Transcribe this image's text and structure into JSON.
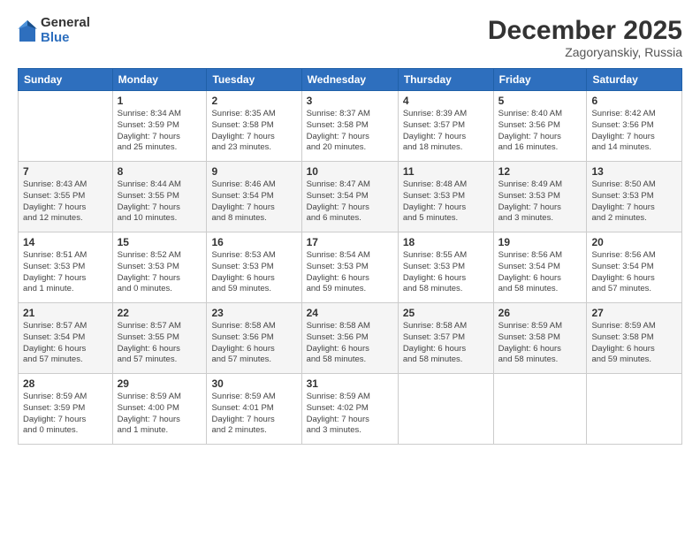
{
  "header": {
    "logo": {
      "general": "General",
      "blue": "Blue"
    },
    "title": "December 2025",
    "subtitle": "Zagoryanskiy, Russia"
  },
  "days_of_week": [
    "Sunday",
    "Monday",
    "Tuesday",
    "Wednesday",
    "Thursday",
    "Friday",
    "Saturday"
  ],
  "weeks": [
    [
      {
        "day": "",
        "info": ""
      },
      {
        "day": "1",
        "info": "Sunrise: 8:34 AM\nSunset: 3:59 PM\nDaylight: 7 hours\nand 25 minutes."
      },
      {
        "day": "2",
        "info": "Sunrise: 8:35 AM\nSunset: 3:58 PM\nDaylight: 7 hours\nand 23 minutes."
      },
      {
        "day": "3",
        "info": "Sunrise: 8:37 AM\nSunset: 3:58 PM\nDaylight: 7 hours\nand 20 minutes."
      },
      {
        "day": "4",
        "info": "Sunrise: 8:39 AM\nSunset: 3:57 PM\nDaylight: 7 hours\nand 18 minutes."
      },
      {
        "day": "5",
        "info": "Sunrise: 8:40 AM\nSunset: 3:56 PM\nDaylight: 7 hours\nand 16 minutes."
      },
      {
        "day": "6",
        "info": "Sunrise: 8:42 AM\nSunset: 3:56 PM\nDaylight: 7 hours\nand 14 minutes."
      }
    ],
    [
      {
        "day": "7",
        "info": "Sunrise: 8:43 AM\nSunset: 3:55 PM\nDaylight: 7 hours\nand 12 minutes."
      },
      {
        "day": "8",
        "info": "Sunrise: 8:44 AM\nSunset: 3:55 PM\nDaylight: 7 hours\nand 10 minutes."
      },
      {
        "day": "9",
        "info": "Sunrise: 8:46 AM\nSunset: 3:54 PM\nDaylight: 7 hours\nand 8 minutes."
      },
      {
        "day": "10",
        "info": "Sunrise: 8:47 AM\nSunset: 3:54 PM\nDaylight: 7 hours\nand 6 minutes."
      },
      {
        "day": "11",
        "info": "Sunrise: 8:48 AM\nSunset: 3:53 PM\nDaylight: 7 hours\nand 5 minutes."
      },
      {
        "day": "12",
        "info": "Sunrise: 8:49 AM\nSunset: 3:53 PM\nDaylight: 7 hours\nand 3 minutes."
      },
      {
        "day": "13",
        "info": "Sunrise: 8:50 AM\nSunset: 3:53 PM\nDaylight: 7 hours\nand 2 minutes."
      }
    ],
    [
      {
        "day": "14",
        "info": "Sunrise: 8:51 AM\nSunset: 3:53 PM\nDaylight: 7 hours\nand 1 minute."
      },
      {
        "day": "15",
        "info": "Sunrise: 8:52 AM\nSunset: 3:53 PM\nDaylight: 7 hours\nand 0 minutes."
      },
      {
        "day": "16",
        "info": "Sunrise: 8:53 AM\nSunset: 3:53 PM\nDaylight: 6 hours\nand 59 minutes."
      },
      {
        "day": "17",
        "info": "Sunrise: 8:54 AM\nSunset: 3:53 PM\nDaylight: 6 hours\nand 59 minutes."
      },
      {
        "day": "18",
        "info": "Sunrise: 8:55 AM\nSunset: 3:53 PM\nDaylight: 6 hours\nand 58 minutes."
      },
      {
        "day": "19",
        "info": "Sunrise: 8:56 AM\nSunset: 3:54 PM\nDaylight: 6 hours\nand 58 minutes."
      },
      {
        "day": "20",
        "info": "Sunrise: 8:56 AM\nSunset: 3:54 PM\nDaylight: 6 hours\nand 57 minutes."
      }
    ],
    [
      {
        "day": "21",
        "info": "Sunrise: 8:57 AM\nSunset: 3:54 PM\nDaylight: 6 hours\nand 57 minutes."
      },
      {
        "day": "22",
        "info": "Sunrise: 8:57 AM\nSunset: 3:55 PM\nDaylight: 6 hours\nand 57 minutes."
      },
      {
        "day": "23",
        "info": "Sunrise: 8:58 AM\nSunset: 3:56 PM\nDaylight: 6 hours\nand 57 minutes."
      },
      {
        "day": "24",
        "info": "Sunrise: 8:58 AM\nSunset: 3:56 PM\nDaylight: 6 hours\nand 58 minutes."
      },
      {
        "day": "25",
        "info": "Sunrise: 8:58 AM\nSunset: 3:57 PM\nDaylight: 6 hours\nand 58 minutes."
      },
      {
        "day": "26",
        "info": "Sunrise: 8:59 AM\nSunset: 3:58 PM\nDaylight: 6 hours\nand 58 minutes."
      },
      {
        "day": "27",
        "info": "Sunrise: 8:59 AM\nSunset: 3:58 PM\nDaylight: 6 hours\nand 59 minutes."
      }
    ],
    [
      {
        "day": "28",
        "info": "Sunrise: 8:59 AM\nSunset: 3:59 PM\nDaylight: 7 hours\nand 0 minutes."
      },
      {
        "day": "29",
        "info": "Sunrise: 8:59 AM\nSunset: 4:00 PM\nDaylight: 7 hours\nand 1 minute."
      },
      {
        "day": "30",
        "info": "Sunrise: 8:59 AM\nSunset: 4:01 PM\nDaylight: 7 hours\nand 2 minutes."
      },
      {
        "day": "31",
        "info": "Sunrise: 8:59 AM\nSunset: 4:02 PM\nDaylight: 7 hours\nand 3 minutes."
      },
      {
        "day": "",
        "info": ""
      },
      {
        "day": "",
        "info": ""
      },
      {
        "day": "",
        "info": ""
      }
    ]
  ]
}
